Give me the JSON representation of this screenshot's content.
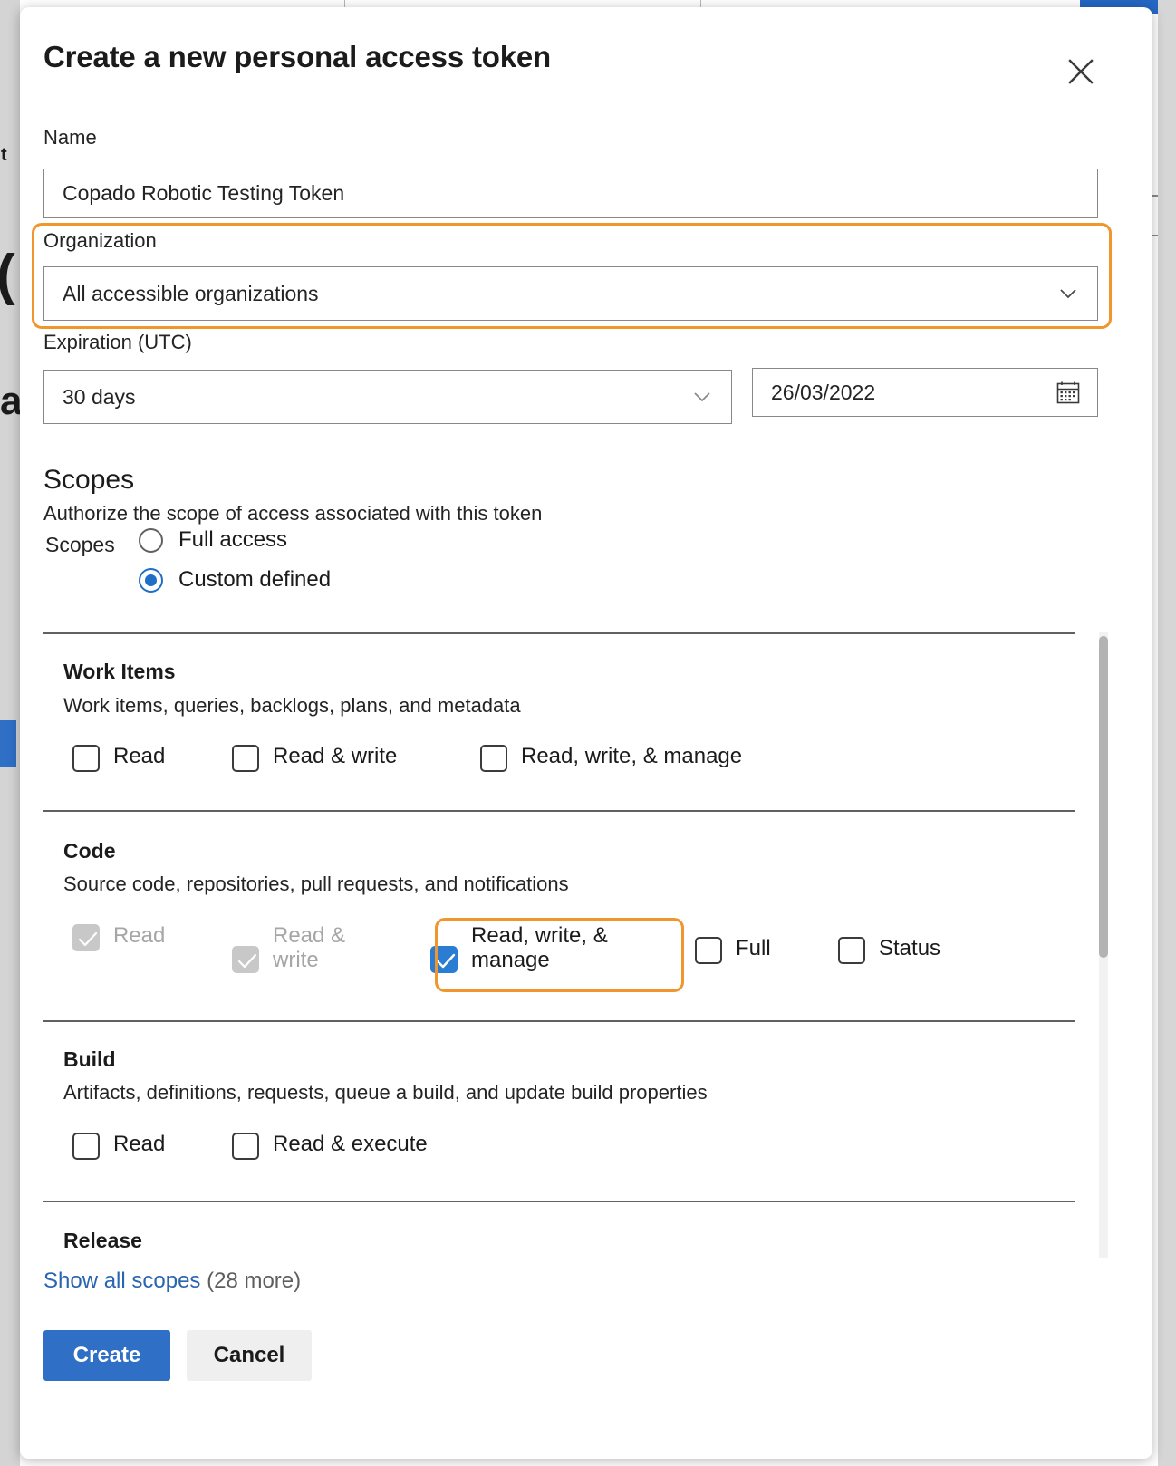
{
  "dialog": {
    "title": "Create a new personal access token",
    "close_icon": "close-icon"
  },
  "name_field": {
    "label": "Name",
    "value": "Copado Robotic Testing Token",
    "placeholder": ""
  },
  "organization_field": {
    "label": "Organization",
    "value": "All accessible organizations",
    "chevron_icon": "chevron-down-icon",
    "highlighted": true
  },
  "expiration_field": {
    "label": "Expiration (UTC)",
    "preset_value": "30 days",
    "chevron_icon": "chevron-down-icon",
    "date_value": "26/03/2022",
    "calendar_icon": "calendar-icon"
  },
  "scopes": {
    "heading": "Scopes",
    "description": "Authorize the scope of access associated with this token",
    "radio_group_label": "Scopes",
    "options": [
      {
        "label": "Full access",
        "selected": false
      },
      {
        "label": "Custom defined",
        "selected": true
      }
    ],
    "groups": [
      {
        "title": "Work Items",
        "description": "Work items, queries, backlogs, plans, and metadata",
        "checkboxes": [
          {
            "label": "Read",
            "checked": false,
            "disabled": false,
            "highlighted": false
          },
          {
            "label": "Read & write",
            "checked": false,
            "disabled": false,
            "highlighted": false
          },
          {
            "label": "Read, write, & manage",
            "checked": false,
            "disabled": false,
            "highlighted": false
          }
        ]
      },
      {
        "title": "Code",
        "description": "Source code, repositories, pull requests, and notifications",
        "checkboxes": [
          {
            "label": "Read",
            "checked": true,
            "disabled": true,
            "highlighted": false
          },
          {
            "label": "Read & write",
            "checked": true,
            "disabled": true,
            "highlighted": false
          },
          {
            "label": "Read, write, & manage",
            "checked": true,
            "disabled": false,
            "highlighted": true
          },
          {
            "label": "Full",
            "checked": false,
            "disabled": false,
            "highlighted": false
          },
          {
            "label": "Status",
            "checked": false,
            "disabled": false,
            "highlighted": false
          }
        ]
      },
      {
        "title": "Build",
        "description": "Artifacts, definitions, requests, queue a build, and update build properties",
        "checkboxes": [
          {
            "label": "Read",
            "checked": false,
            "disabled": false,
            "highlighted": false
          },
          {
            "label": "Read & execute",
            "checked": false,
            "disabled": false,
            "highlighted": false
          }
        ]
      },
      {
        "title": "Release",
        "description": "",
        "checkboxes": []
      }
    ],
    "show_all_link": "Show all scopes",
    "show_all_count": "(28 more)"
  },
  "footer": {
    "create_label": "Create",
    "cancel_label": "Cancel"
  },
  "colors": {
    "accent_blue": "#2f6fc6",
    "checkbox_blue": "#2b7cd3",
    "highlight_orange": "#f0962c",
    "link_blue": "#2a65b0",
    "disabled_grey": "#c8c8c8"
  }
}
